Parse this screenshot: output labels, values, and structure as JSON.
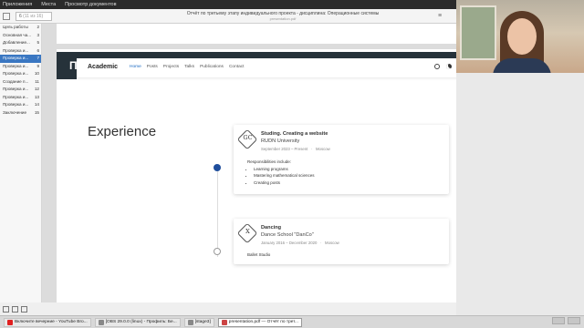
{
  "topbar": {
    "menus": [
      "Приложения",
      "Места",
      "Просмотр документов"
    ]
  },
  "app": {
    "page_input": "6",
    "page_count": "(11 из 16)",
    "doc_title": "Отчёт по третьему этапу индивидуального проекта - дисциплина: Операционные системы",
    "doc_subtitle": "presentation.pdf"
  },
  "sidebar": {
    "items": [
      {
        "label": "Цель работы",
        "page": "2"
      },
      {
        "label": "Основная ча...",
        "page": "3"
      },
      {
        "label": "Добавление...",
        "page": "5"
      },
      {
        "label": "Проверка и...",
        "page": "6"
      },
      {
        "label": "Проверка и...",
        "page": "7"
      },
      {
        "label": "Проверка и...",
        "page": "9"
      },
      {
        "label": "Проверка и...",
        "page": "10"
      },
      {
        "label": "Создание п...",
        "page": "11"
      },
      {
        "label": "Проверка и...",
        "page": "12"
      },
      {
        "label": "Проверка и...",
        "page": "13"
      },
      {
        "label": "Проверка и...",
        "page": "14"
      },
      {
        "label": "Заключение",
        "page": "15"
      }
    ],
    "active_index": 4
  },
  "slide": {
    "header": "Проверка изменений на сайте"
  },
  "site": {
    "brand": "Academic",
    "nav": [
      "Home",
      "Posts",
      "Projects",
      "Talks",
      "Publications",
      "Contact"
    ],
    "section_title": "Experience",
    "cards": [
      {
        "logo": "GC",
        "title": "Studing. Creating a website",
        "org": "RUDN University",
        "dates": "September 2023 – Present",
        "location": "Moscow",
        "body_label": "Responsibilities include:",
        "items": [
          "Learning programs",
          "Mastering mathematical sciences",
          "Creating posts"
        ]
      },
      {
        "logo": "X",
        "title": "Dancing",
        "org": "Dance School \"DanCo\"",
        "dates": "January 2016 – December 2020",
        "location": "Moscow",
        "body_label": "Ballet Studio"
      }
    ]
  },
  "taskbar": {
    "tasks": [
      {
        "label": "Включите вечерние - YouTube Bro..."
      },
      {
        "label": "[OBS 29.0.0 (linux) - Профиль: Бе..."
      },
      {
        "label": "[stage3]"
      },
      {
        "label": "presentation.pdf — Отчёт по трет..."
      }
    ]
  }
}
